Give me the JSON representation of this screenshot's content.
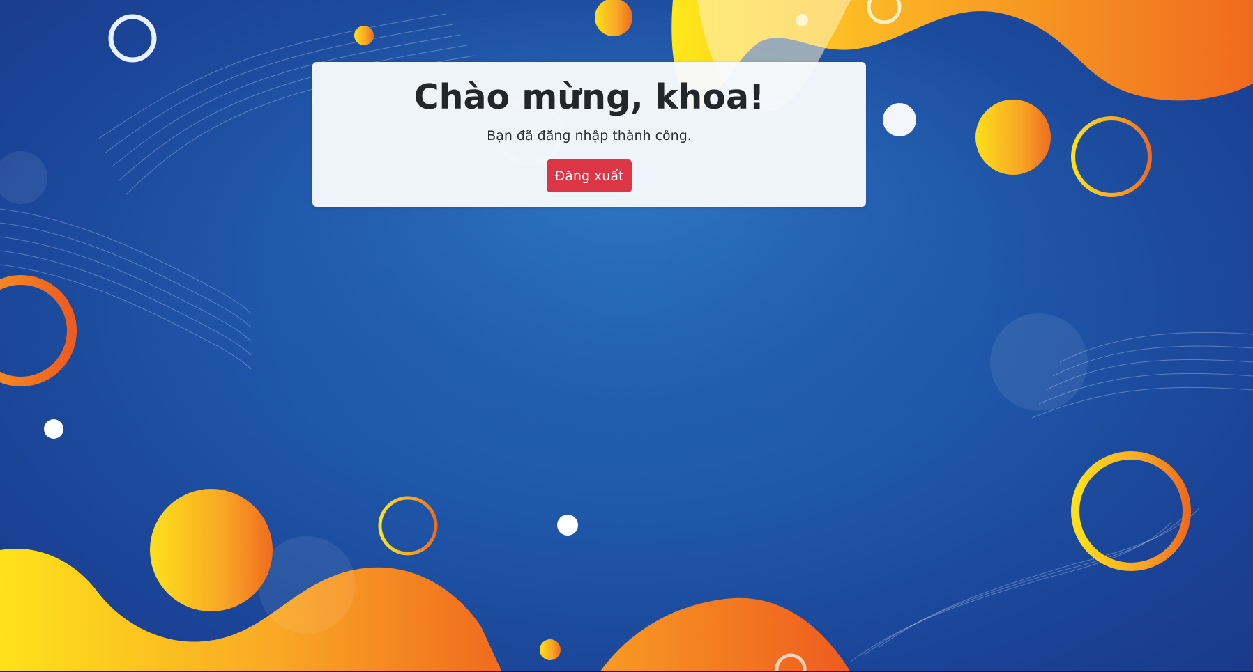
{
  "welcome": {
    "title": "Chào mừng, khoa!",
    "subtitle": "Bạn đã đăng nhập thành công.",
    "logout_label": "Đăng xuất"
  },
  "colors": {
    "background_blue": "#1f58aa",
    "blob_orange": "#f07a1f",
    "blob_yellow": "#fbd61c",
    "logout_button": "#dc3545"
  }
}
